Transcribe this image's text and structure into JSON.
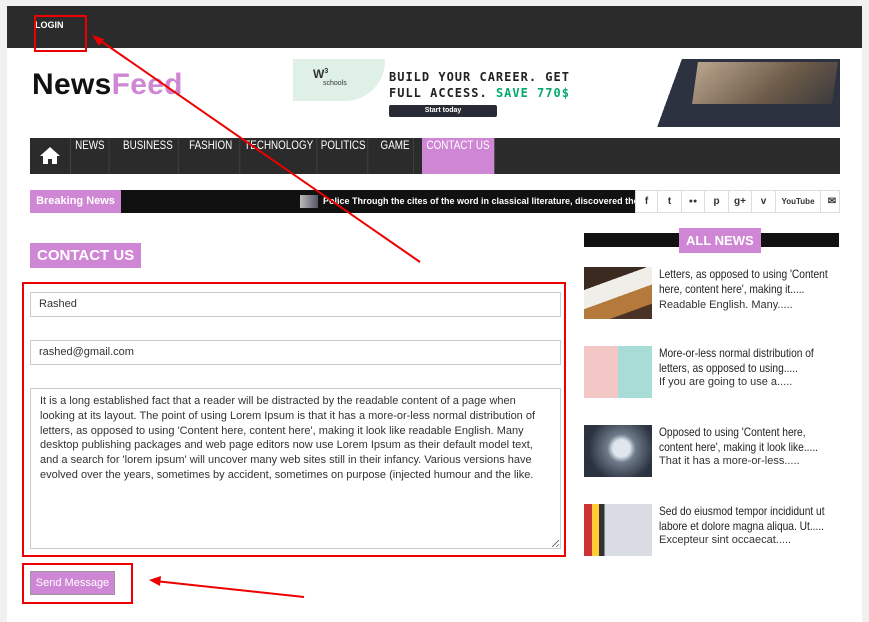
{
  "topbar": {
    "login_label": "LOGIN"
  },
  "logo": {
    "part1": "News",
    "part2": "Feed"
  },
  "ad": {
    "brand": "W",
    "brand_sup": "3",
    "brand_sub": "schools",
    "line1": "BUILD YOUR CAREER. GET",
    "line2": "FULL ACCESS.",
    "line2_highlight": "SAVE 770$",
    "cta": "Start today"
  },
  "nav": {
    "home_icon": "home-icon",
    "items": [
      "NEWS",
      "BUSINESS",
      "FASHION",
      "TECHNOLOGY",
      "POLITICS",
      "GAME",
      "CONTACT US"
    ],
    "active_index": 6
  },
  "breaking": {
    "label": "Breaking News",
    "ticker": "Police Through the cites of the word in classical literature, discovered the"
  },
  "social_icons": [
    "f",
    "t",
    "●●",
    "p",
    "g+",
    "v",
    "YouTube",
    "✉"
  ],
  "contact": {
    "title": "CONTACT US",
    "name_value": "Rashed",
    "email_value": "rashed@gmail.com",
    "message_value": "It is a long established fact that a reader will be distracted by the readable content of a page when looking at its layout. The point of using Lorem Ipsum is that it has a more-or-less normal distribution of letters, as opposed to using 'Content here, content here', making it look like readable English. Many desktop publishing packages and web page editors now use Lorem Ipsum as their default model text, and a search for 'lorem ipsum' will uncover many web sites still in their infancy. Various versions have evolved over the years, sometimes by accident, sometimes on purpose (injected humour and the like.",
    "send_label": "Send Message"
  },
  "sidebar": {
    "title": "ALL NEWS",
    "posts": [
      {
        "title": "Letters, as opposed to using 'Content here, content here', making it.....",
        "excerpt": "Readable English. Many....."
      },
      {
        "title": "More-or-less normal distribution of letters, as opposed to using.....",
        "excerpt": "If you are going to use a....."
      },
      {
        "title": "Opposed to using 'Content here, content here', making it look like.....",
        "excerpt": "That it has a more-or-less....."
      },
      {
        "title": "Sed do eiusmod tempor incididunt ut labore et dolore magna aliqua. Ut.....",
        "excerpt": "Excepteur sint occaecat....."
      }
    ]
  },
  "colors": {
    "accent": "#cf86d4",
    "dark": "#2b2b2b",
    "annotation": "#e00000"
  }
}
